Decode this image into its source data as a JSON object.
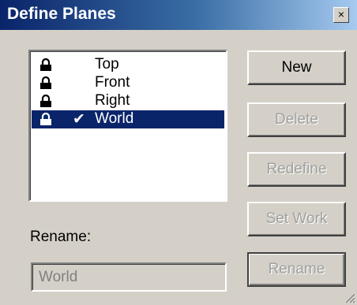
{
  "window": {
    "title": "Define Planes",
    "close_label": "×"
  },
  "planes": {
    "items": [
      {
        "label": "Top",
        "locked": true,
        "checked": false,
        "selected": false
      },
      {
        "label": "Front",
        "locked": true,
        "checked": false,
        "selected": false
      },
      {
        "label": "Right",
        "locked": true,
        "checked": false,
        "selected": false
      },
      {
        "label": "World",
        "locked": true,
        "checked": true,
        "check_mark": "✔",
        "selected": true
      }
    ]
  },
  "buttons": {
    "new": "New",
    "delete": "Delete",
    "redefine": "Redefine",
    "set_work": "Set Work",
    "rename": "Rename"
  },
  "rename": {
    "label": "Rename:",
    "value": "World"
  },
  "colors": {
    "title_start": "#0a246a",
    "title_end": "#a6caf0",
    "selection": "#0a246a",
    "face": "#d4d0c8"
  },
  "icons": {
    "lock": "lock-icon",
    "check": "check-icon",
    "close": "close-icon",
    "resize": "resize-grip-icon"
  }
}
